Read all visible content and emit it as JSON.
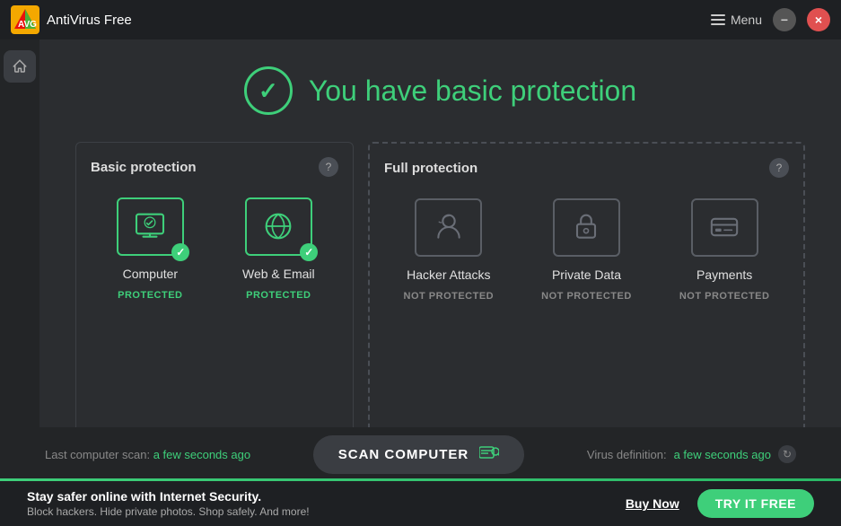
{
  "app": {
    "logo_alt": "AVG logo",
    "name": "AntiVirus Free",
    "menu_label": "Menu",
    "min_label": "−",
    "close_label": "×"
  },
  "header": {
    "title": "You have basic protection",
    "check_icon": "✓"
  },
  "basic_section": {
    "title": "Basic protection",
    "help": "?",
    "items": [
      {
        "name": "Computer",
        "status": "PROTECTED",
        "protected": true
      },
      {
        "name": "Web & Email",
        "status": "PROTECTED",
        "protected": true
      }
    ]
  },
  "full_section": {
    "title": "Full protection",
    "help": "?",
    "items": [
      {
        "name": "Hacker Attacks",
        "status": "NOT PROTECTED",
        "protected": false
      },
      {
        "name": "Private Data",
        "status": "NOT PROTECTED",
        "protected": false
      },
      {
        "name": "Payments",
        "status": "NOT PROTECTED",
        "protected": false
      }
    ]
  },
  "bottom": {
    "scan_label": "Last computer scan:",
    "scan_time": "a few seconds ago",
    "scan_btn": "SCAN COMPUTER",
    "virus_label": "Virus definition:",
    "virus_time": "a few seconds ago"
  },
  "promo": {
    "main_text": "Stay safer online with Internet Security.",
    "sub_text": "Block hackers. Hide private photos. Shop safely. And more!",
    "buy_now": "Buy Now",
    "try_free": "TRY IT FREE"
  }
}
